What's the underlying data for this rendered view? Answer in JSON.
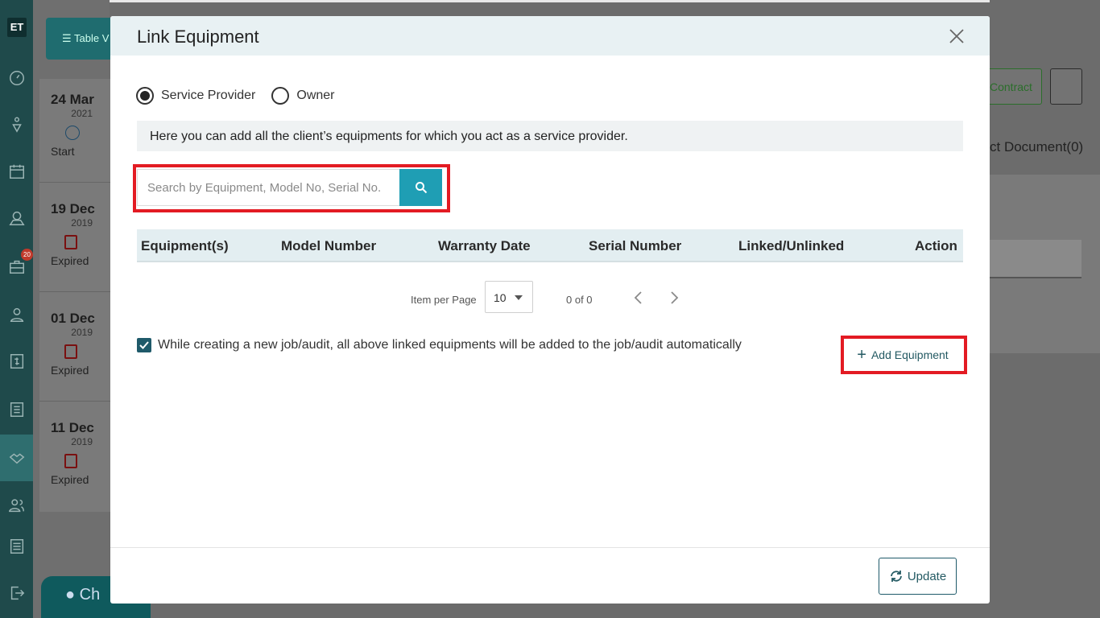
{
  "rail": {
    "logo": "ET",
    "badge_count": "20",
    "icons": [
      "dashboard-icon",
      "user-tree-icon",
      "calendar-icon",
      "map-icon",
      "briefcase-icon",
      "person-icon",
      "invoice-icon",
      "list-icon",
      "handshake-icon",
      "users-icon",
      "settings-icon",
      "logout-icon"
    ]
  },
  "background": {
    "toolbar_label": "Table V",
    "timeline": [
      {
        "day": "24 Mar",
        "year": "2021",
        "status": "Start"
      },
      {
        "day": "19 Dec",
        "year": "2019",
        "status": "Expired"
      },
      {
        "day": "01 Dec",
        "year": "2019",
        "status": "Expired"
      },
      {
        "day": "11 Dec",
        "year": "2019",
        "status": "Expired"
      }
    ],
    "contract_label": "Contract",
    "document_label": "ct Document(0)",
    "chat_label": "Ch"
  },
  "modal": {
    "title": "Link Equipment",
    "radios": [
      {
        "label": "Service Provider",
        "selected": true
      },
      {
        "label": "Owner",
        "selected": false
      }
    ],
    "info": "Here you can add all the client’s equipments for which you act as a service provider.",
    "search": {
      "placeholder": "Search by Equipment, Model No, Serial No.",
      "value": ""
    },
    "table": {
      "columns": [
        "Equipment(s)",
        "Model Number",
        "Warranty Date",
        "Serial Number",
        "Linked/Unlinked",
        "Action"
      ],
      "rows": []
    },
    "pagination": {
      "items_label": "Item per Page",
      "page_size": "10",
      "range": "0 of 0"
    },
    "auto_add": {
      "checked": true,
      "text": "While creating a new job/audit, all above linked equipments will be added to the job/audit automatically"
    },
    "add_equipment_label": "Add Equipment",
    "update_label": "Update"
  },
  "colors": {
    "accent": "#1f9eb4",
    "highlight": "#e31b23",
    "rail": "#1f4a4b",
    "header": "#e8f1f3"
  }
}
